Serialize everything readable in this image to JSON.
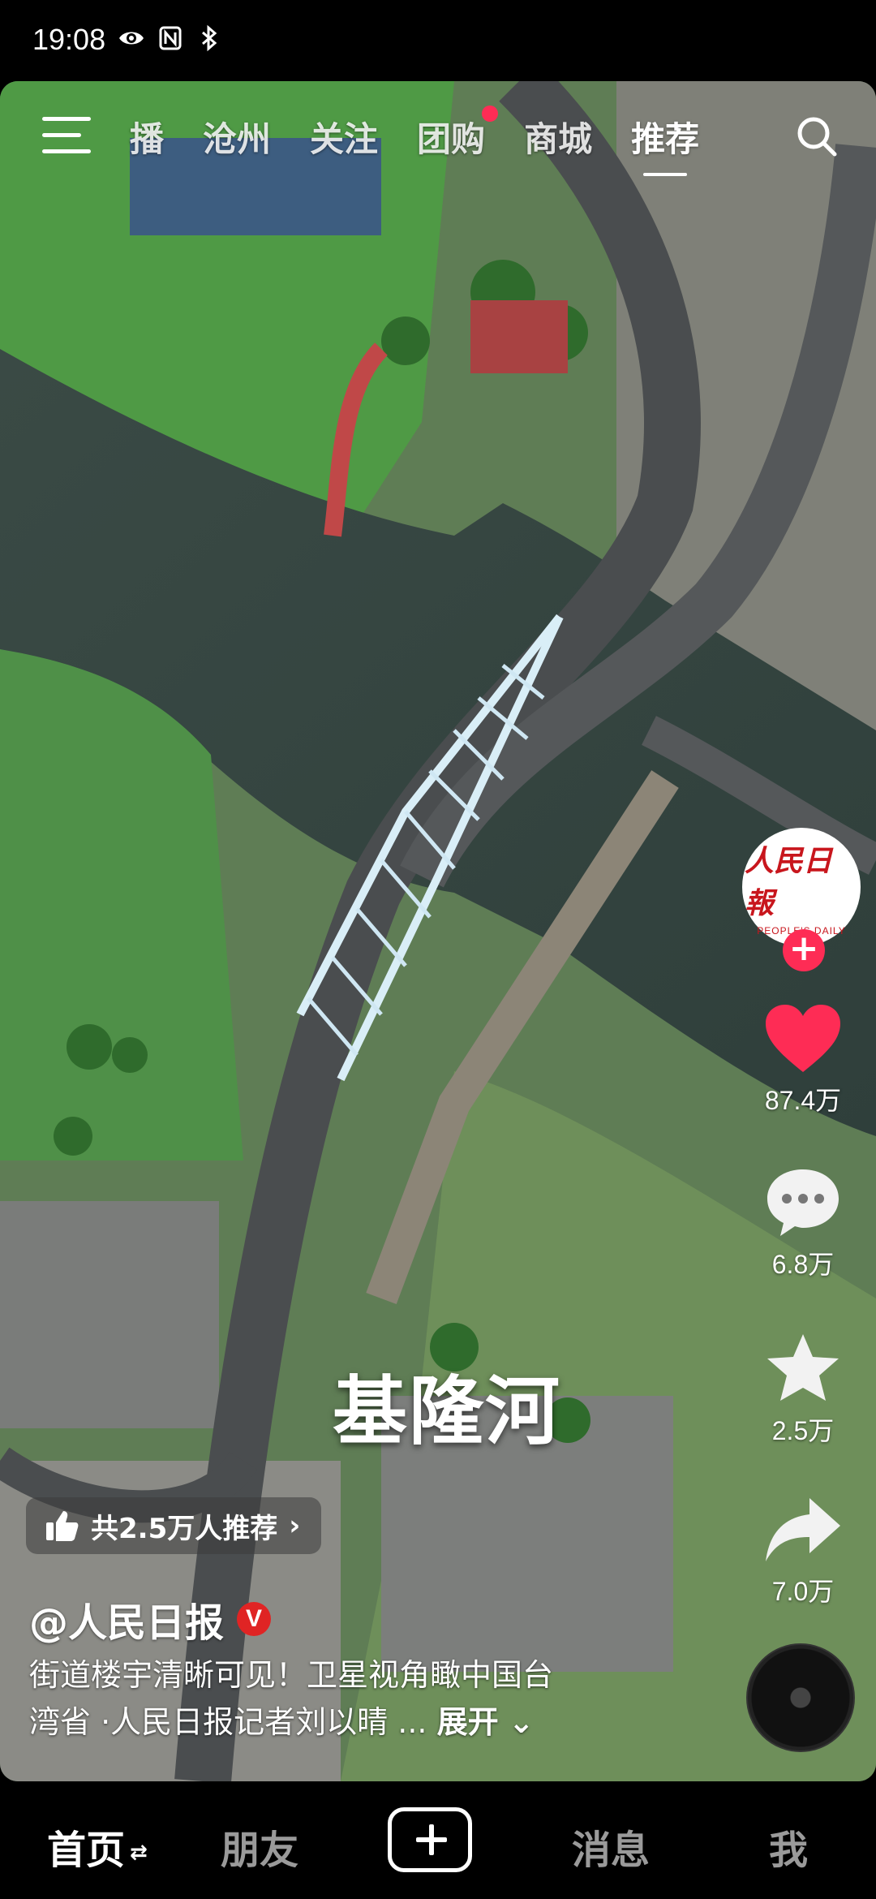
{
  "status_bar": {
    "time": "19:08",
    "icons": [
      "eye-icon",
      "nfc-icon",
      "bluetooth-icon"
    ]
  },
  "top_nav": {
    "tabs": [
      {
        "label": "播"
      },
      {
        "label": "沧州"
      },
      {
        "label": "关注"
      },
      {
        "label": "团购",
        "has_dot": true
      },
      {
        "label": "商城"
      },
      {
        "label": "推荐",
        "active": true
      }
    ]
  },
  "video": {
    "overlay_caption": "基隆河"
  },
  "actions": {
    "avatar_text": "人民日報",
    "avatar_subtext": "PEOPLE'S DAILY",
    "follow_symbol": "+",
    "like_count": "87.4万",
    "comment_count": "6.8万",
    "favorite_count": "2.5万",
    "share_count": "7.0万"
  },
  "info": {
    "recommend_text": "共2.5万人推荐",
    "recommend_chevron": "›",
    "author": "@人民日报",
    "verified_mark": "V",
    "description_line1": "街道楼宇清晰可见！卫星视角瞰中国台",
    "description_line2": "湾省  ·人民日报记者刘以晴 ...",
    "expand_label": "展开"
  },
  "bottom_nav": {
    "home": "首页",
    "home_switch": "⇄",
    "friends": "朋友",
    "messages": "消息",
    "me": "我"
  },
  "colors": {
    "accent": "#fe2c55",
    "verified": "#e02424",
    "brand_red": "#c8161d"
  }
}
